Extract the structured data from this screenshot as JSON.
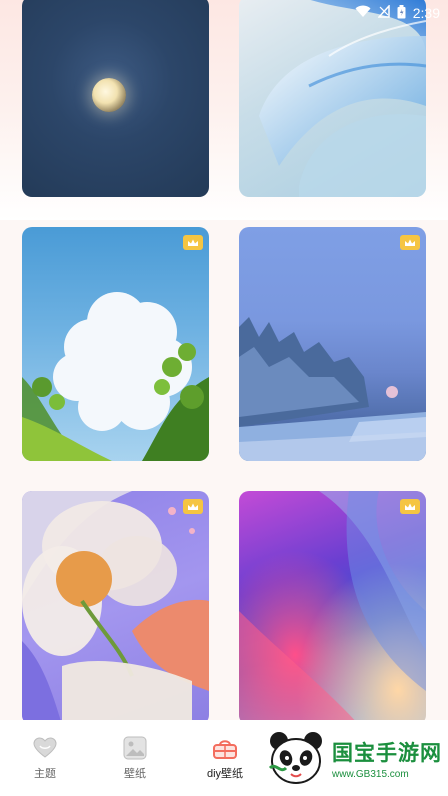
{
  "status_bar": {
    "time": "2:39",
    "icons": [
      "wifi-icon",
      "signal-icon",
      "battery-icon"
    ]
  },
  "wallpapers": [
    {
      "theme": "full-moon-night-sky",
      "premium": false
    },
    {
      "theme": "blue-white-petals",
      "premium": false
    },
    {
      "theme": "white-cloud-blue-sky-green-leaves",
      "premium": true
    },
    {
      "theme": "frosted-trees-blue-lake",
      "premium": true
    },
    {
      "theme": "illustrated-white-flower-purple",
      "premium": true
    },
    {
      "theme": "abstract-gradient-waves",
      "premium": true
    }
  ],
  "premium_badge_color": "#f5c542",
  "tab_bar": {
    "tabs": [
      {
        "label": "主题",
        "icon": "heart-icon",
        "active": false
      },
      {
        "label": "壁纸",
        "icon": "image-icon",
        "active": false
      },
      {
        "label": "diy壁纸",
        "icon": "basket-icon",
        "active": true
      }
    ],
    "active_color": "#f36d5e"
  },
  "watermark": {
    "title": "国宝手游网",
    "url": "www.GB315.com"
  }
}
